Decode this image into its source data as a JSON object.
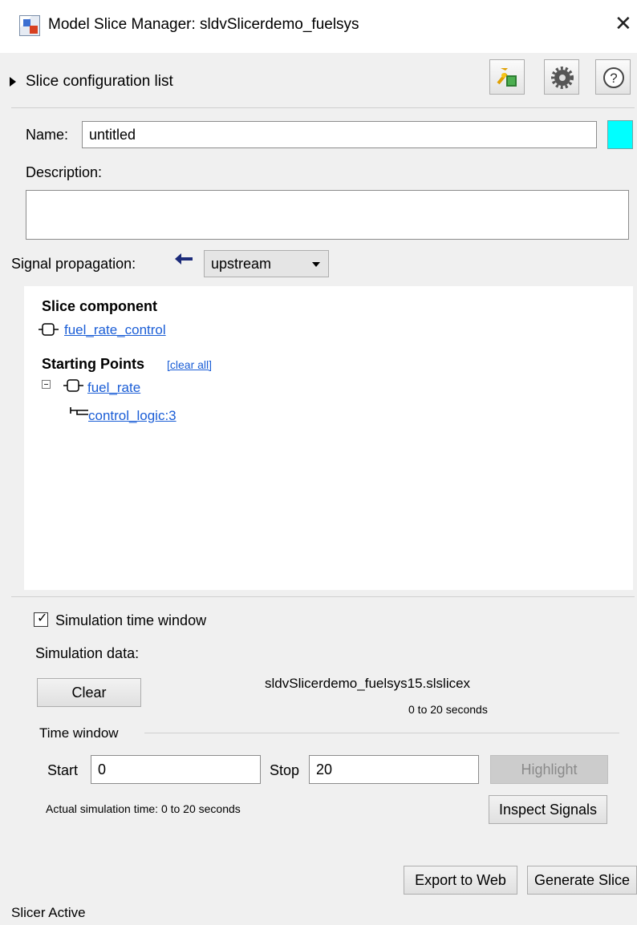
{
  "window": {
    "title": "Model Slice Manager: sldvSlicerdemo_fuelsys",
    "close": "✕"
  },
  "toolbar": {
    "collapse_label": "Slice configuration list",
    "buttons": [
      {
        "icon": "slice-highlight-icon"
      },
      {
        "icon": "gear-icon"
      },
      {
        "icon": "help-icon",
        "glyph": "?"
      }
    ]
  },
  "config": {
    "name_label": "Name:",
    "name_value": "untitled",
    "color": "#00ffff",
    "description_label": "Description:",
    "description_value": "",
    "signal_propagation_label": "Signal propagation:",
    "signal_propagation_value": "upstream"
  },
  "slice": {
    "component_heading": "Slice component",
    "component_link": "fuel_rate_control",
    "starting_points_heading": "Starting Points",
    "clear_all": "[clear all]",
    "points": [
      {
        "label": "fuel_rate",
        "icon": "outport-icon"
      },
      {
        "label": "control_logic:3",
        "icon": "signal-line-icon"
      }
    ]
  },
  "simulation": {
    "window_checkbox_label": "Simulation time window",
    "window_checked": true,
    "data_label": "Simulation data:",
    "clear_label": "Clear",
    "file_name": "sldvSlicerdemo_fuelsys15.slslicex",
    "file_range": "0 to 20 seconds",
    "time_window_label": "Time window",
    "start_label": "Start",
    "start_value": "0",
    "stop_label": "Stop",
    "stop_value": "20",
    "highlight_label": "Highlight",
    "actual_time": "Actual simulation time: 0 to 20 seconds",
    "inspect_label": "Inspect Signals"
  },
  "footer": {
    "export_label": "Export to Web",
    "generate_label": "Generate Slice",
    "status": "Slicer Active"
  }
}
